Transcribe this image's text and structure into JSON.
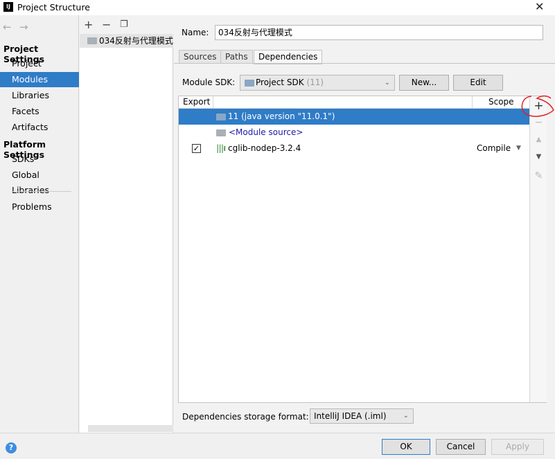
{
  "window": {
    "title": "Project Structure",
    "logo": "IJ"
  },
  "sidebar": {
    "project_settings": "Project Settings",
    "items": [
      {
        "label": "Project"
      },
      {
        "label": "Modules",
        "selected": true
      },
      {
        "label": "Libraries"
      },
      {
        "label": "Facets"
      },
      {
        "label": "Artifacts"
      }
    ],
    "platform_settings": "Platform Settings",
    "platform_items": [
      {
        "label": "SDKs"
      },
      {
        "label": "Global Libraries"
      }
    ],
    "problems": "Problems"
  },
  "modules": {
    "items": [
      {
        "label": "034反射与代理模式"
      }
    ]
  },
  "main": {
    "name_label": "Name:",
    "name_value": "034反射与代理模式",
    "tabs": [
      {
        "label": "Sources"
      },
      {
        "label": "Paths"
      },
      {
        "label": "Dependencies",
        "active": true
      }
    ],
    "sdk_label": "Module SDK:",
    "sdk_value": "Project SDK",
    "sdk_version": "(11)",
    "new_button": "New...",
    "edit_button": "Edit",
    "table": {
      "headers": {
        "export": "Export",
        "scope": "Scope"
      },
      "rows": [
        {
          "name": "11 (java version \"11.0.1\")",
          "selected": true
        },
        {
          "name": "<Module source>"
        },
        {
          "name": "cglib-nodep-3.2.4",
          "export": true,
          "scope": "Compile"
        }
      ]
    },
    "format_label": "Dependencies storage format:",
    "format_value": "IntelliJ IDEA (.iml)"
  },
  "footer": {
    "ok": "OK",
    "cancel": "Cancel",
    "apply": "Apply",
    "help": "?"
  },
  "colors": {
    "selection": "#2f7cc7",
    "annotation": "#e02020",
    "link": "#1a1aa6"
  }
}
